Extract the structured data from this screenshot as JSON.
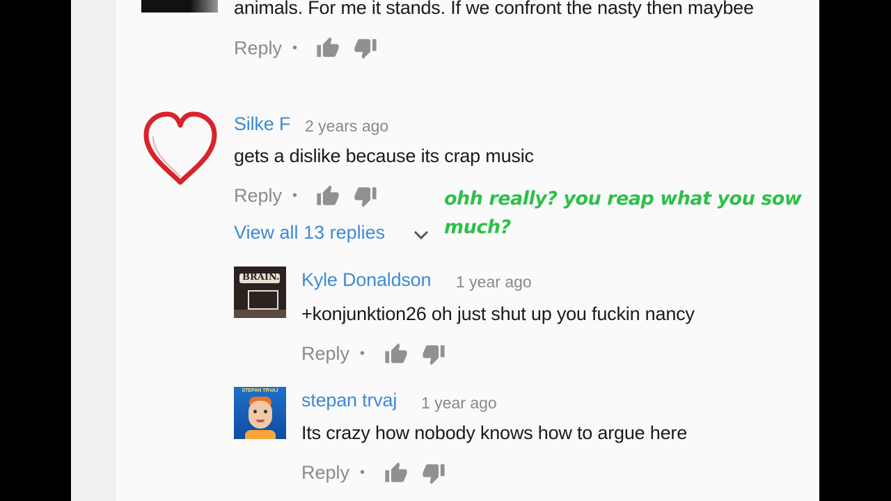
{
  "comments": [
    {
      "text": "animals. For me it stands. If we confront the nasty then maybee",
      "reply_label": "Reply",
      "separator": "•"
    },
    {
      "author": "Silke F",
      "time": "2 years ago",
      "text": "gets a dislike because its crap music",
      "reply_label": "Reply",
      "separator": "•",
      "view_replies": "View all 13 replies"
    }
  ],
  "replies": [
    {
      "author": "Kyle Donaldson",
      "time": "1 year ago",
      "text": "+konjunktion26 oh just shut up you fuckin nancy",
      "reply_label": "Reply",
      "separator": "•",
      "avatar_text": "BRAIN."
    },
    {
      "author": "stepan trvaj",
      "time": "1 year ago",
      "text": "Its crazy how nobody knows how to argue here",
      "reply_label": "Reply",
      "separator": "•",
      "avatar_text": "STEPAN TRVAJ"
    }
  ],
  "overlay_caption": "ohh really? you reap what you sow much?",
  "colors": {
    "author": "#3e8ad6",
    "caption": "#2fbf4a",
    "heart": "#d8232a"
  }
}
